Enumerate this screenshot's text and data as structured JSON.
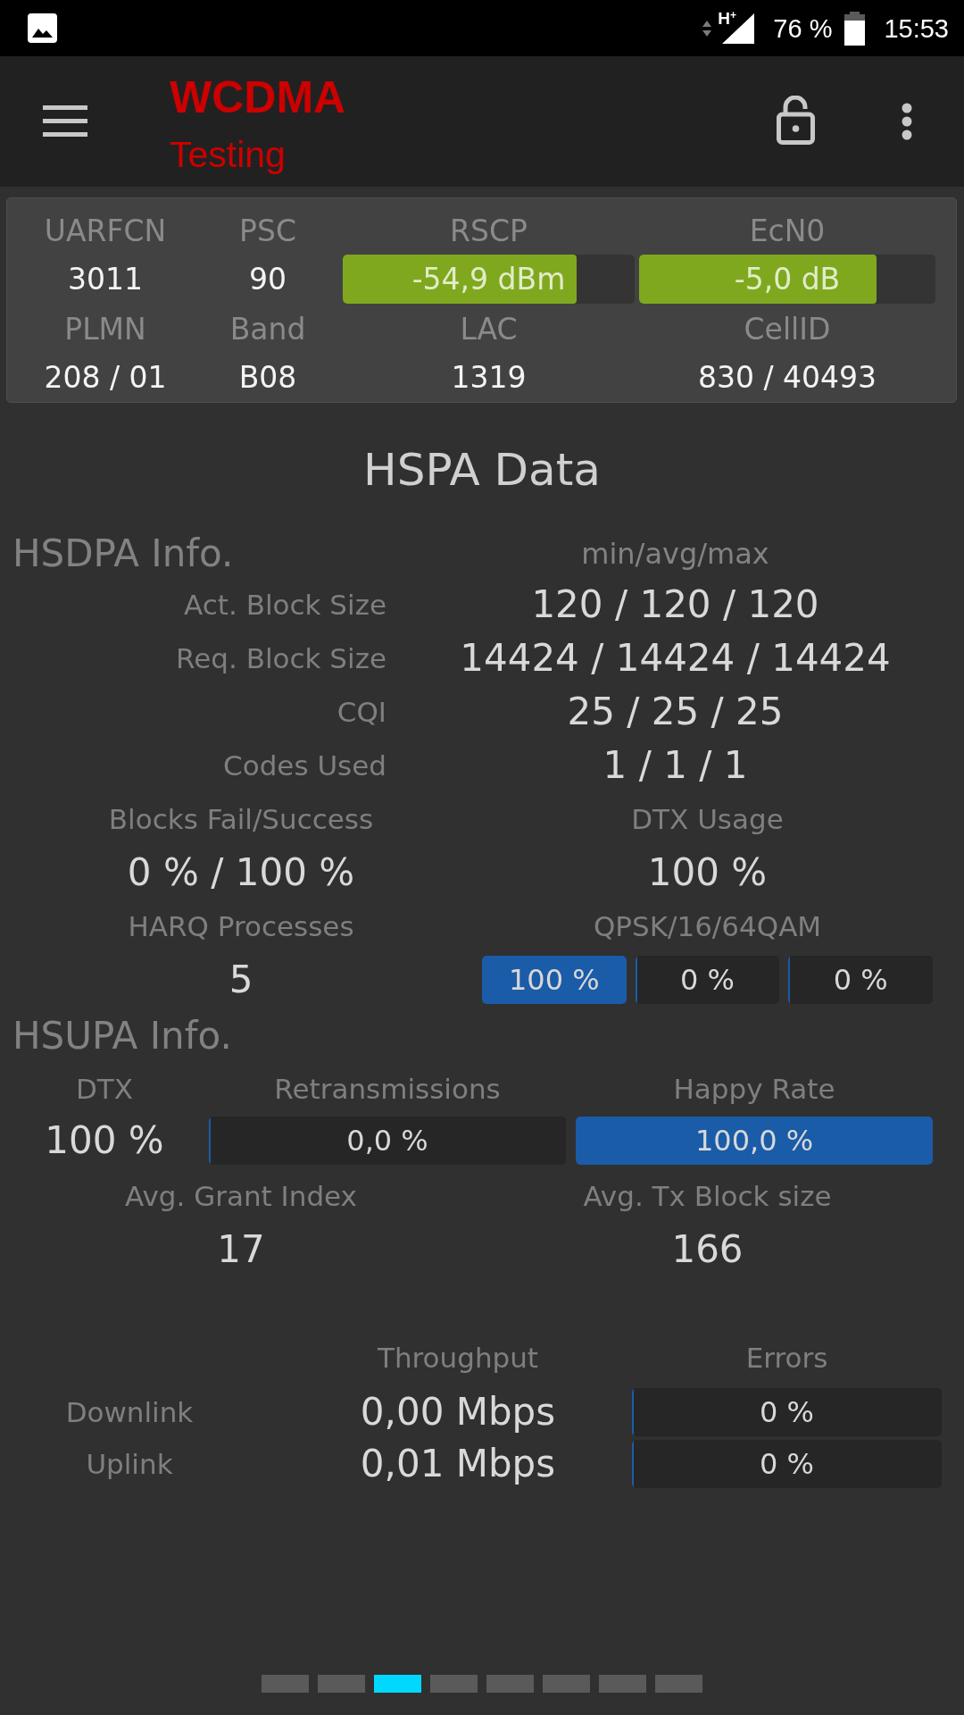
{
  "status_bar": {
    "network_type": "H$^{+}$",
    "battery": "76 %",
    "time": "15:53"
  },
  "toolbar": {
    "title": "WCDMA",
    "subtitle": "Testing"
  },
  "cell_panel": {
    "rows": [
      [
        {
          "kind": "text",
          "label": "UARFCN",
          "value": "3011"
        },
        {
          "kind": "text",
          "label": "PSC",
          "value": "90"
        },
        {
          "kind": "bar",
          "label": "RSCP",
          "value": "-54,9 dBm",
          "level": 0.8
        },
        {
          "kind": "bar",
          "label": "EcN0",
          "value": "-5,0 dB",
          "level": 0.8
        }
      ],
      [
        {
          "kind": "text",
          "label": "PLMN",
          "value": "208 / 01"
        },
        {
          "kind": "text",
          "label": "Band",
          "value": "B08"
        },
        {
          "kind": "text",
          "label": "LAC",
          "value": "1319"
        },
        {
          "kind": "text",
          "label": "CellID",
          "value": "830 / 40493"
        }
      ]
    ]
  },
  "title": "HSPA Data",
  "hsdpa": {
    "heading": "HSDPA Info.",
    "column_heading": "min/avg/max",
    "rows": [
      {
        "label": "Act. Block Size",
        "value": "120 / 120 / 120"
      },
      {
        "label": "Req. Block Size",
        "value": "14424 / 14424 / 14424"
      },
      {
        "label": "CQI",
        "value": "25 / 25 / 25"
      },
      {
        "label": "Codes Used",
        "value": "1 / 1 / 1"
      }
    ],
    "stats": [
      {
        "kind": "text",
        "label": "Blocks Fail/Success",
        "value": "0 % / 100 %"
      },
      {
        "kind": "text",
        "label": "DTX Usage",
        "value": "100 %"
      },
      {
        "kind": "text",
        "label": "HARQ Processes",
        "value": "5"
      },
      {
        "kind": "bars",
        "label": "QPSK/16/64QAM",
        "bars": [
          {
            "value": "100 %",
            "level": 1
          },
          {
            "value": "0 %",
            "level": 0
          },
          {
            "value": "0 %",
            "level": 0
          }
        ]
      }
    ]
  },
  "hsupa": {
    "heading": "HSUPA Info.",
    "top": [
      {
        "kind": "text",
        "label": "DTX",
        "value": "100 %"
      },
      {
        "kind": "bar",
        "label": "Retransmissions",
        "value": "0,0 %",
        "level": 0
      },
      {
        "kind": "bar",
        "label": "Happy Rate",
        "value": "100,0 %",
        "level": 1
      }
    ],
    "stats": [
      {
        "kind": "text",
        "label": "Avg. Grant Index",
        "value": "17"
      },
      {
        "kind": "text",
        "label": "Avg. Tx Block size",
        "value": "166"
      }
    ]
  },
  "throughput": {
    "headers": [
      "Throughput",
      "Errors"
    ],
    "rows": [
      {
        "label": "Downlink",
        "value": "0,00 Mbps",
        "error": "0 %",
        "level": 0
      },
      {
        "label": "Uplink",
        "value": "0,01 Mbps",
        "error": "0 %",
        "level": 0
      }
    ]
  },
  "pages": [
    {
      "selected": false
    },
    {
      "selected": false
    },
    {
      "selected": true
    },
    {
      "selected": false
    },
    {
      "selected": false
    },
    {
      "selected": false
    },
    {
      "selected": false
    },
    {
      "selected": false
    }
  ]
}
